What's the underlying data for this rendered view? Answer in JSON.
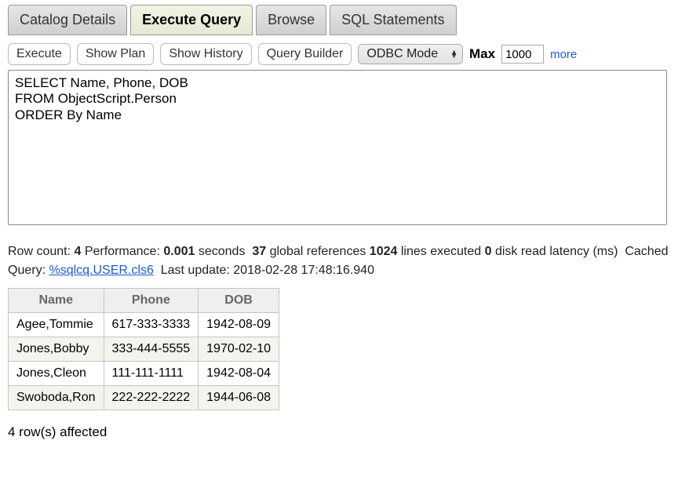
{
  "tabs": [
    {
      "label": "Catalog Details",
      "active": false
    },
    {
      "label": "Execute Query",
      "active": true
    },
    {
      "label": "Browse",
      "active": false
    },
    {
      "label": "SQL Statements",
      "active": false
    }
  ],
  "toolbar": {
    "execute": "Execute",
    "show_plan": "Show Plan",
    "show_history": "Show History",
    "query_builder": "Query Builder",
    "mode_selected": "ODBC Mode",
    "max_label": "Max",
    "max_value": "1000",
    "more": "more"
  },
  "query_text": "SELECT Name, Phone, DOB\nFROM ObjectScript.Person\nORDER By Name",
  "stats": {
    "row_count_label": "Row count:",
    "row_count": "4",
    "perf_label": "Performance:",
    "perf_seconds": "0.001",
    "seconds_word": "seconds",
    "global_refs": "37",
    "global_refs_label": "global references",
    "lines_exec": "1024",
    "lines_exec_label": "lines executed",
    "disk_read": "0",
    "disk_read_label": "disk read latency (ms)",
    "cached_label": "Cached",
    "query_label": "Query:",
    "cached_query_link": "%sqlcq.USER.cls6",
    "last_update_label": "Last update:",
    "last_update": "2018-02-28 17:48:16.940"
  },
  "results": {
    "headers": [
      "Name",
      "Phone",
      "DOB"
    ],
    "rows": [
      [
        "Agee,Tommie",
        "617-333-3333",
        "1942-08-09"
      ],
      [
        "Jones,Bobby",
        "333-444-5555",
        "1970-02-10"
      ],
      [
        "Jones,Cleon",
        "111-111-1111",
        "1942-08-04"
      ],
      [
        "Swoboda,Ron",
        "222-222-2222",
        "1944-06-08"
      ]
    ]
  },
  "affected": "4 row(s) affected"
}
